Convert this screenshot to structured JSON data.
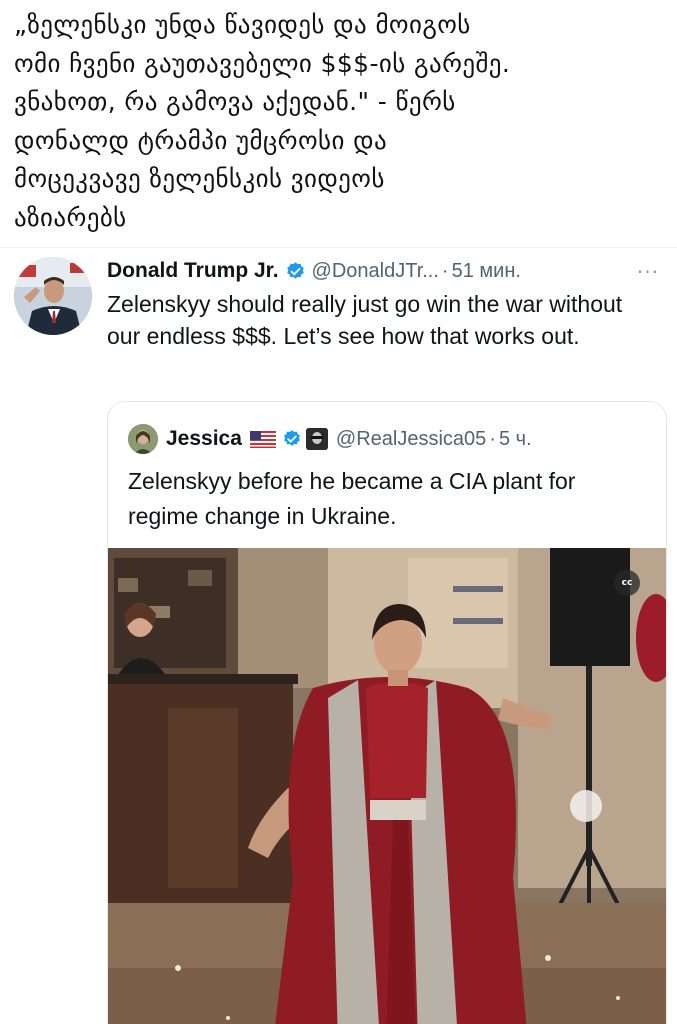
{
  "caption": {
    "lines": [
      "„ზელენსკი უნდა წავიდეს და მოიგოს",
      "ომი ჩვენი გაუთავებელი $$$-ის გარეშე.",
      "ვნახოთ, რა გამოვა აქედან.\" - წერს",
      "დონალდ ტრამპი უმცროსი და",
      "მოცეკვავე ზელენსკის ვიდეოს",
      "აზიარებს"
    ]
  },
  "tweet": {
    "author_name": "Donald Trump Jr.",
    "handle": "@DonaldJTr...",
    "separator": "·",
    "time": "51 мин.",
    "more_label": "···",
    "text": "Zelenskyy should really just go win the war without our endless $$$. Let’s see how that works out."
  },
  "quote": {
    "author_name": "Jessica",
    "handle": "@RealJessica05",
    "separator": "·",
    "time": "5 ч.",
    "text": "Zelenskyy before he became a CIA plant for regime change in Ukraine.",
    "cc_label": "cc"
  },
  "colors": {
    "verified": "#1d9bf0",
    "text_primary": "#0f1419",
    "text_secondary": "#536471",
    "border": "#e4e8eb"
  }
}
